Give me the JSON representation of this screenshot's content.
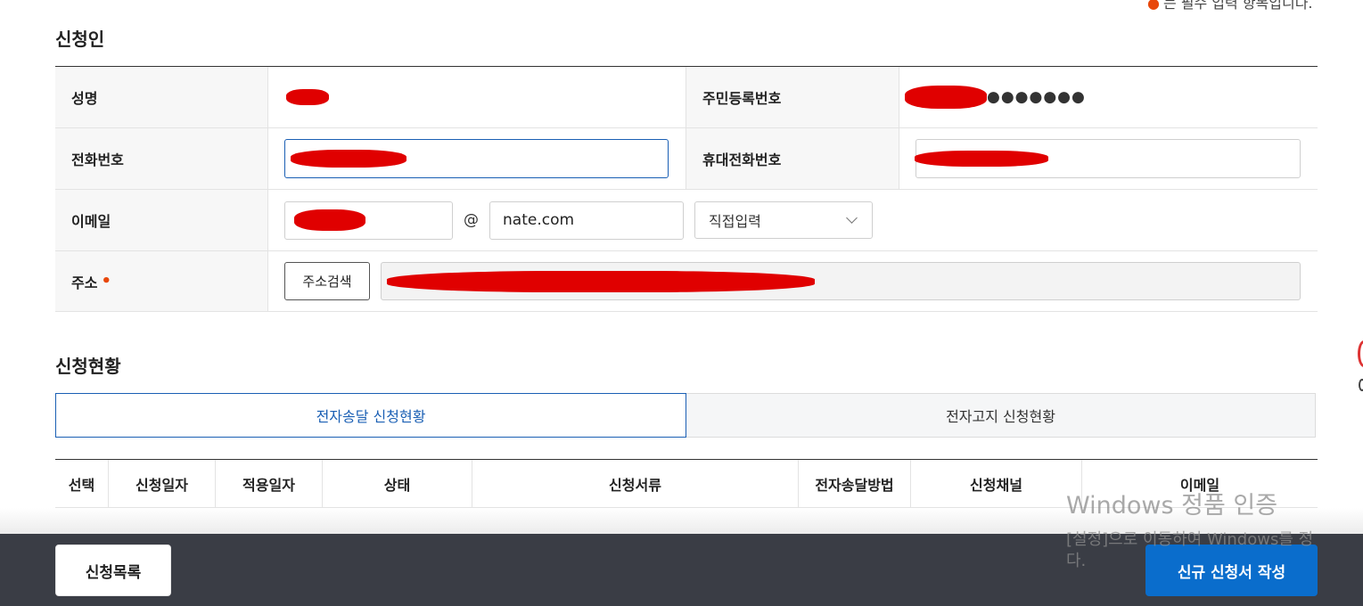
{
  "top_note": "는 필수 입력 항목입니다.",
  "applicant": {
    "section_title": "신청인",
    "name_label": "성명",
    "rrn_label": "주민등록번호",
    "rrn_masked": "●●●●●●●",
    "phone_label": "전화번호",
    "mobile_label": "휴대전화번호",
    "email_label": "이메일",
    "email_at": "@",
    "email_domain": "nate.com",
    "email_select": "직접입력",
    "address_label": "주소",
    "address_search_button": "주소검색"
  },
  "status": {
    "section_title": "신청현황",
    "tabs": [
      {
        "label": "전자송달 신청현황",
        "active": true
      },
      {
        "label": "전자고지 신청현황",
        "active": false
      }
    ],
    "columns": [
      "선택",
      "신청일자",
      "적용일자",
      "상태",
      "신청서류",
      "전자송달방법",
      "신청채널",
      "이메일"
    ]
  },
  "footer": {
    "list_button": "신청목록",
    "new_button": "신규 신청서 작성"
  },
  "watermark": {
    "title": "Windows 정품 인증",
    "line1": "[설정]으로 이동하여 Windows를 정",
    "line2": "다."
  },
  "colors": {
    "accent": "#0a6dcc",
    "required_dot": "#e8470b",
    "redaction": "#e00000",
    "footer_bg": "#3a3d45"
  }
}
